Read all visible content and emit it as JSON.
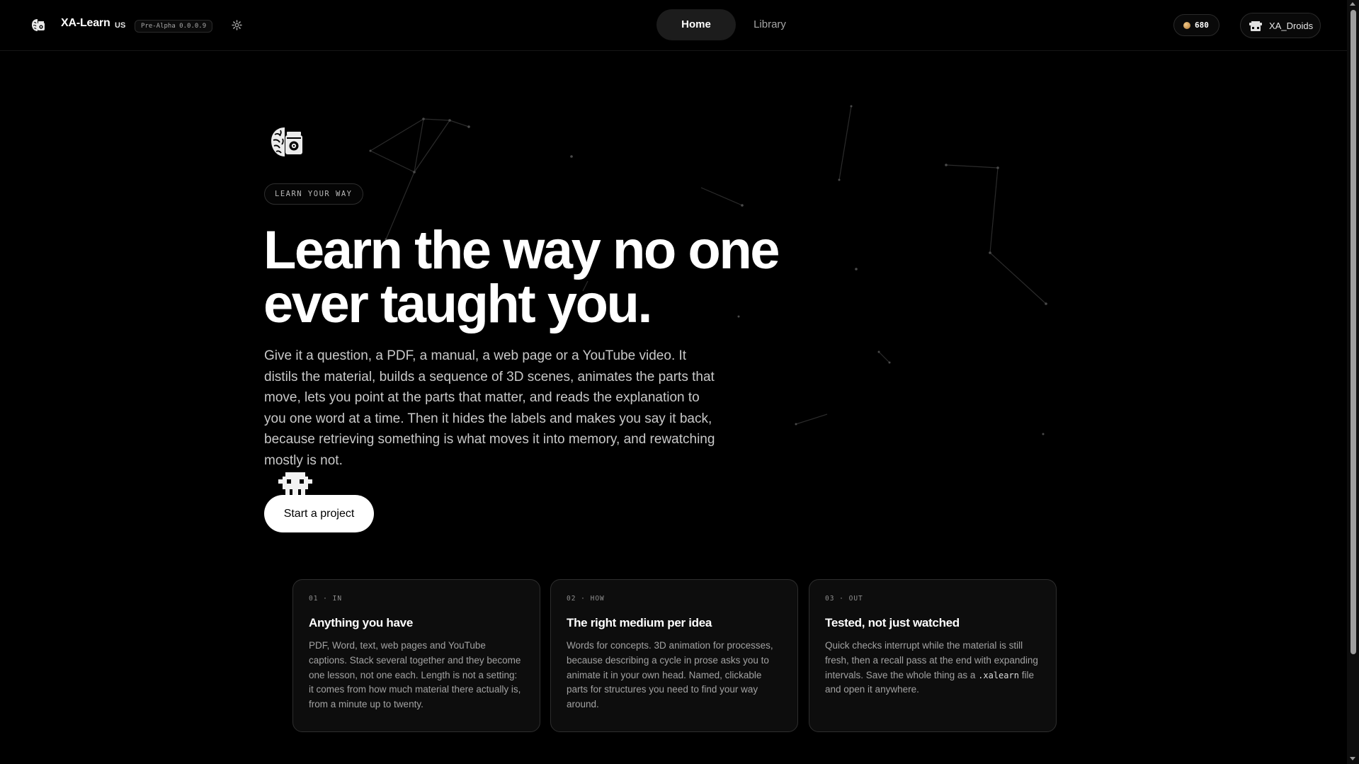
{
  "header": {
    "brand_name": "XA-Learn",
    "region": "US",
    "version": "Pre-Alpha 0.0.0.9",
    "settings_icon": "gear-icon",
    "nav": [
      {
        "label": "Home",
        "active": true
      },
      {
        "label": "Library",
        "active": false
      }
    ],
    "credits": "680",
    "account_name": "XA_Droids"
  },
  "hero": {
    "eyebrow": "LEARN YOUR WAY",
    "headline_line1": "Learn the way no one",
    "headline_line2": "ever taught you.",
    "intro": "Give it a question, a PDF, a manual, a web page or a YouTube video. It distils the material, builds a sequence of 3D scenes, animates the parts that move, lets you point at the parts that matter, and reads the explanation to you one word at a time. Then it hides the labels and makes you say it back, because retrieving something is what moves it into memory, and rewatching mostly is not.",
    "cta": "Start a project"
  },
  "features": [
    {
      "tag": "01 · IN",
      "title": "Anything you have",
      "body": "PDF, Word, text, web pages and YouTube captions. Stack several together and they become one lesson, not one each. Length is not a setting: it comes from how much material there actually is, from a minute up to twenty."
    },
    {
      "tag": "02 · HOW",
      "title": "The right medium per idea",
      "body": "Words for concepts. 3D animation for processes, because describing a cycle in prose asks you to animate it in your own head. Named, clickable parts for structures you need to find your way around."
    },
    {
      "tag": "03 · OUT",
      "title": "Tested, not just watched",
      "body_before": "Quick checks interrupt while the material is still fresh, then a recall pass at the end with expanding intervals. Save the whole thing as a",
      "body_code": ".xalearn",
      "body_after": "file and open it anywhere."
    }
  ],
  "colors": {
    "background": "#000000",
    "card_background": "#0d0d0d",
    "border": "#2e2e2e",
    "muted_text": "#a2a2a2",
    "accent_coin": "#d49a52"
  }
}
